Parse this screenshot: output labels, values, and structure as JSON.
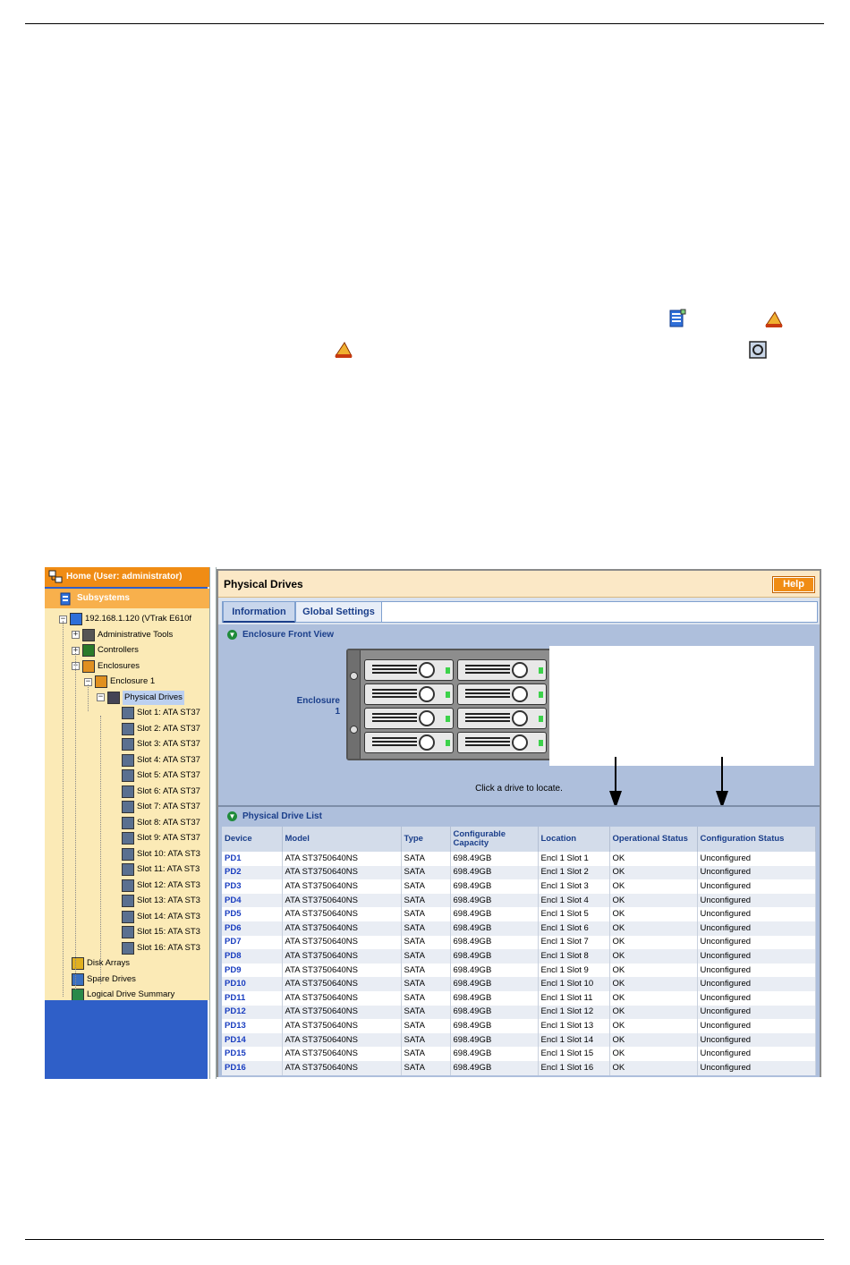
{
  "tree": {
    "home_label": "Home (User: administrator)",
    "subsystems_label": "Subsystems",
    "items": [
      {
        "label": "192.168.1.120 (VTrak E610f",
        "level": 1,
        "toggle": "−",
        "icon": "subsystem-icon"
      },
      {
        "label": "Administrative Tools",
        "level": 2,
        "toggle": "+",
        "icon": "admin-tools-icon"
      },
      {
        "label": "Controllers",
        "level": 2,
        "toggle": "+",
        "icon": "controllers-icon"
      },
      {
        "label": "Enclosures",
        "level": 2,
        "toggle": "−",
        "icon": "enclosures-icon"
      },
      {
        "label": "Enclosure 1",
        "level": 3,
        "toggle": "−",
        "icon": "enclosure-icon"
      },
      {
        "label": "Physical Drives",
        "level": 4,
        "toggle": "−",
        "icon": "physical-drives-icon",
        "selected": true
      },
      {
        "label": "Slot 1: ATA ST37",
        "level": 5,
        "icon": "drive-icon"
      },
      {
        "label": "Slot 2: ATA ST37",
        "level": 5,
        "icon": "drive-icon"
      },
      {
        "label": "Slot 3: ATA ST37",
        "level": 5,
        "icon": "drive-icon"
      },
      {
        "label": "Slot 4: ATA ST37",
        "level": 5,
        "icon": "drive-icon"
      },
      {
        "label": "Slot 5: ATA ST37",
        "level": 5,
        "icon": "drive-icon"
      },
      {
        "label": "Slot 6: ATA ST37",
        "level": 5,
        "icon": "drive-icon"
      },
      {
        "label": "Slot 7: ATA ST37",
        "level": 5,
        "icon": "drive-icon"
      },
      {
        "label": "Slot 8: ATA ST37",
        "level": 5,
        "icon": "drive-icon"
      },
      {
        "label": "Slot 9: ATA ST37",
        "level": 5,
        "icon": "drive-icon"
      },
      {
        "label": "Slot 10: ATA ST3",
        "level": 5,
        "icon": "drive-icon"
      },
      {
        "label": "Slot 11: ATA ST3",
        "level": 5,
        "icon": "drive-icon"
      },
      {
        "label": "Slot 12: ATA ST3",
        "level": 5,
        "icon": "drive-icon"
      },
      {
        "label": "Slot 13: ATA ST3",
        "level": 5,
        "icon": "drive-icon"
      },
      {
        "label": "Slot 14: ATA ST3",
        "level": 5,
        "icon": "drive-icon"
      },
      {
        "label": "Slot 15: ATA ST3",
        "level": 5,
        "icon": "drive-icon"
      },
      {
        "label": "Slot 16: ATA ST3",
        "level": 5,
        "icon": "drive-icon"
      },
      {
        "label": "Disk Arrays",
        "level": 2,
        "icon": "disk-arrays-icon"
      },
      {
        "label": "Spare Drives",
        "level": 2,
        "icon": "spare-drives-icon"
      },
      {
        "label": "Logical Drive Summary",
        "level": 2,
        "icon": "logical-drive-icon"
      }
    ]
  },
  "panel": {
    "title": "Physical Drives",
    "help_label": "Help",
    "tabs": [
      "Information",
      "Global Settings"
    ],
    "enclosure_section_title": "Enclosure Front View",
    "enclosure_label_line1": "Enclosure",
    "enclosure_label_line2": "1",
    "locate_hint": "Click a drive to locate.",
    "list_section_title": "Physical Drive List"
  },
  "table": {
    "columns": [
      "Device",
      "Model",
      "Type",
      "Configurable Capacity",
      "Location",
      "Operational Status",
      "Configuration Status"
    ],
    "rows": [
      [
        "PD1",
        "ATA ST3750640NS",
        "SATA",
        "698.49GB",
        "Encl 1 Slot 1",
        "OK",
        "Unconfigured"
      ],
      [
        "PD2",
        "ATA ST3750640NS",
        "SATA",
        "698.49GB",
        "Encl 1 Slot 2",
        "OK",
        "Unconfigured"
      ],
      [
        "PD3",
        "ATA ST3750640NS",
        "SATA",
        "698.49GB",
        "Encl 1 Slot 3",
        "OK",
        "Unconfigured"
      ],
      [
        "PD4",
        "ATA ST3750640NS",
        "SATA",
        "698.49GB",
        "Encl 1 Slot 4",
        "OK",
        "Unconfigured"
      ],
      [
        "PD5",
        "ATA ST3750640NS",
        "SATA",
        "698.49GB",
        "Encl 1 Slot 5",
        "OK",
        "Unconfigured"
      ],
      [
        "PD6",
        "ATA ST3750640NS",
        "SATA",
        "698.49GB",
        "Encl 1 Slot 6",
        "OK",
        "Unconfigured"
      ],
      [
        "PD7",
        "ATA ST3750640NS",
        "SATA",
        "698.49GB",
        "Encl 1 Slot 7",
        "OK",
        "Unconfigured"
      ],
      [
        "PD8",
        "ATA ST3750640NS",
        "SATA",
        "698.49GB",
        "Encl 1 Slot 8",
        "OK",
        "Unconfigured"
      ],
      [
        "PD9",
        "ATA ST3750640NS",
        "SATA",
        "698.49GB",
        "Encl 1 Slot 9",
        "OK",
        "Unconfigured"
      ],
      [
        "PD10",
        "ATA ST3750640NS",
        "SATA",
        "698.49GB",
        "Encl 1 Slot 10",
        "OK",
        "Unconfigured"
      ],
      [
        "PD11",
        "ATA ST3750640NS",
        "SATA",
        "698.49GB",
        "Encl 1 Slot 11",
        "OK",
        "Unconfigured"
      ],
      [
        "PD12",
        "ATA ST3750640NS",
        "SATA",
        "698.49GB",
        "Encl 1 Slot 12",
        "OK",
        "Unconfigured"
      ],
      [
        "PD13",
        "ATA ST3750640NS",
        "SATA",
        "698.49GB",
        "Encl 1 Slot 13",
        "OK",
        "Unconfigured"
      ],
      [
        "PD14",
        "ATA ST3750640NS",
        "SATA",
        "698.49GB",
        "Encl 1 Slot 14",
        "OK",
        "Unconfigured"
      ],
      [
        "PD15",
        "ATA ST3750640NS",
        "SATA",
        "698.49GB",
        "Encl 1 Slot 15",
        "OK",
        "Unconfigured"
      ],
      [
        "PD16",
        "ATA ST3750640NS",
        "SATA",
        "698.49GB",
        "Encl 1 Slot 16",
        "OK",
        "Unconfigured"
      ]
    ]
  },
  "colors": {
    "accent_orange": "#f08c14",
    "link_blue": "#1a3ec0",
    "section_blue": "#aebfdc",
    "tree_background": "#fbeab6",
    "led_green": "#3cd24a"
  }
}
